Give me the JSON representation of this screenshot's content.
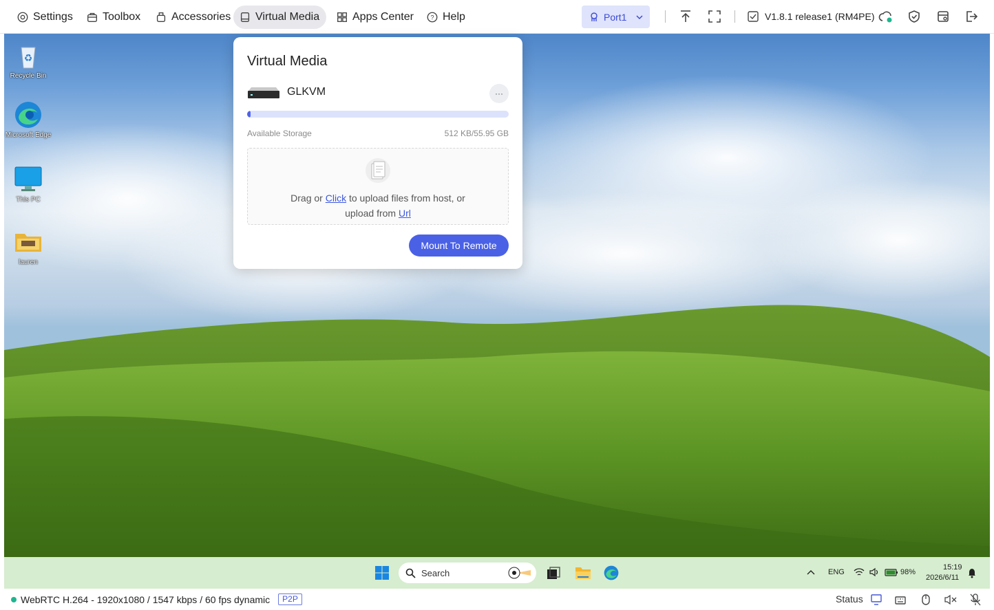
{
  "toolbar": {
    "menu": [
      {
        "label": "Settings",
        "icon": "gear-icon"
      },
      {
        "label": "Toolbox",
        "icon": "toolbox-icon"
      },
      {
        "label": "Accessories",
        "icon": "accessories-icon"
      },
      {
        "label": "Virtual Media",
        "icon": "drive-icon"
      },
      {
        "label": "Apps Center",
        "icon": "apps-icon"
      },
      {
        "label": "Help",
        "icon": "help-icon"
      }
    ],
    "port": "Port1",
    "version": "V1.8.1 release1 (RM4PE)"
  },
  "desktop": {
    "icons": [
      {
        "label": "Recycle Bin"
      },
      {
        "label": "Microsoft Edge"
      },
      {
        "label": "This PC"
      },
      {
        "label": "lauren"
      }
    ]
  },
  "taskbar": {
    "search_placeholder": "Search",
    "language": "ENG",
    "battery": "98%",
    "time": "15:19",
    "date": "2026/6/11"
  },
  "virtual_media": {
    "title": "Virtual Media",
    "device_name": "GLKVM",
    "more_label": "···",
    "storage_label": "Available Storage",
    "storage_value": "512 KB/55.95 GB",
    "storage_used_fraction": 0.01,
    "drop_prefix": "Drag or ",
    "drop_click": "Click",
    "drop_middle": " to upload files from host, or",
    "drop_upload_from": "upload from ",
    "drop_url": "Url",
    "mount_button": "Mount To Remote"
  },
  "statusbar": {
    "stream_info": "WebRTC H.264 - 1920x1080 /  1547 kbps / 60 fps dynamic",
    "p2p": "P2P",
    "status_label": "Status"
  },
  "colors": {
    "accent": "#4a61e6",
    "status_dot": "#1fb58f",
    "taskbar_bg": "#d6edcf"
  }
}
